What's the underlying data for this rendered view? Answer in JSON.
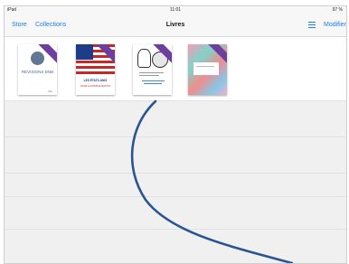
{
  "status_bar": {
    "device": "iPad",
    "time": "11:01",
    "battery": "97 %"
  },
  "nav": {
    "store": "Store",
    "collections": "Collections",
    "title": "Livres",
    "modify": "Modifier"
  },
  "books": [
    {
      "cover_title": "RÉVISIONS DNB",
      "publisher": "Abc"
    },
    {
      "cover_title": "LES ÉTATS-UNIS",
      "cover_subtitle": "DANS LA MONDIALISATION"
    },
    {
      "cover_title": "",
      "cover_subtitle": ""
    },
    {
      "cover_title": ""
    }
  ],
  "colors": {
    "accent": "#1d7cf2",
    "ribbon": "#6a3fa0",
    "stroke": "#2b5592"
  }
}
